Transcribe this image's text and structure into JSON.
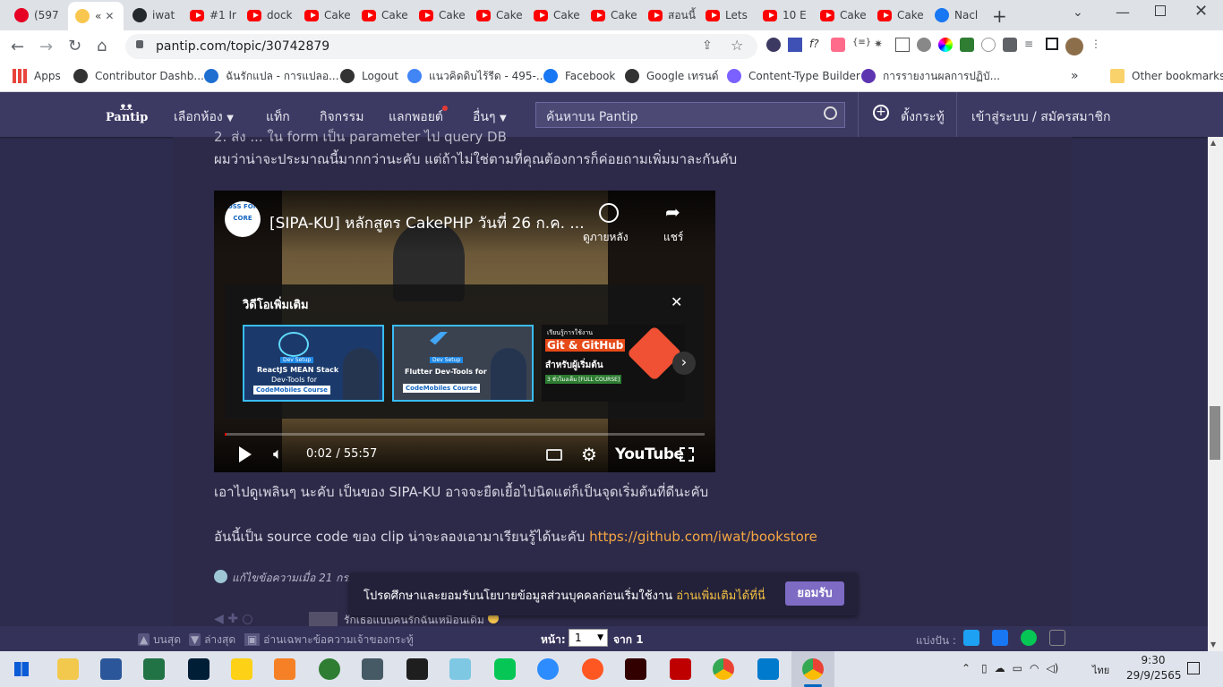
{
  "tabs": [
    {
      "title": "(597",
      "icon": "pinterest"
    },
    {
      "title": "«",
      "icon": "emoji"
    },
    {
      "title": "iwat",
      "icon": "github"
    },
    {
      "title": "#1 Ir",
      "icon": "youtube"
    },
    {
      "title": "dock",
      "icon": "youtube"
    },
    {
      "title": "Cake",
      "icon": "youtube"
    },
    {
      "title": "Cake",
      "icon": "youtube"
    },
    {
      "title": "Cake",
      "icon": "youtube"
    },
    {
      "title": "Cake",
      "icon": "youtube"
    },
    {
      "title": "Cake",
      "icon": "youtube"
    },
    {
      "title": "Cake",
      "icon": "youtube"
    },
    {
      "title": "สอนนี้",
      "icon": "youtube"
    },
    {
      "title": "Lets",
      "icon": "youtube"
    },
    {
      "title": "10 E",
      "icon": "youtube"
    },
    {
      "title": "Cake",
      "icon": "youtube"
    },
    {
      "title": "Cake",
      "icon": "youtube"
    },
    {
      "title": "Nacl",
      "icon": "facebook"
    }
  ],
  "address": {
    "url": "pantip.com/topic/30742879"
  },
  "bookmarks": {
    "apps": "Apps",
    "items": [
      "Contributor Dashb...",
      "ฉันรักแปล - การแปลอ...",
      "Logout",
      "แนวคิดดิบไร้รีด - 495-...",
      "Facebook",
      "Google เทรนด์",
      "Content-Type Builder",
      "การรายงานผลการปฏิบั..."
    ],
    "other": "Other bookmarks"
  },
  "pantip": {
    "logo": "Pantip",
    "nav": [
      "เลือกห้อง",
      "แท็ก",
      "กิจกรรม",
      "แลกพอยต์",
      "อื่นๆ"
    ],
    "search_placeholder": "ค้นหาบน Pantip",
    "create": "ตั้งกระทู้",
    "login": "เข้าสู่ระบบ / สมัครสมาชิก"
  },
  "post": {
    "cut_line": "2. ส่ง ... ใน form เป็น parameter ไป query DB",
    "line1": "ผมว่าน่าจะประมาณนี้มากกว่านะคับ แต่ถ้าไม่ใช่ตามที่คุณต้องการก็ค่อยถามเพิ่มมาละกันคับ",
    "line2": "เอาไปดูเพลินๆ นะคับ เป็นของ SIPA-KU อาจจะยืดเยื้อไปนิดแต่ก็เป็นจุดเริ่มต้นที่ดีนะคับ",
    "line3": "อันนี้เป็น source code ของ clip น่าจะลองเอามาเรียนรู้ได้นะคับ ",
    "link": "https://github.com/iwat/bookstore",
    "edit_note": "แก้ไขข้อความเมื่อ 21 กร...",
    "reply_preview": "รักเธอแบบคนรักฉันเหมือนเดิม"
  },
  "video": {
    "channel_badge": "OSS FOR CORE",
    "title": "[SIPA-KU] หลักสูตร CakePHP วันที่ 26 ก.ค. ...",
    "watch_later": "ดูภายหลัง",
    "share": "แชร์",
    "more_videos": "วิดีโอเพิ่มเติม",
    "thumbs": [
      {
        "big": "ReactJS MEAN Stack",
        "sub": "Dev-Tools for",
        "badge": "CodeMobiles Course",
        "chip": "Dev Setup"
      },
      {
        "big": "Flutter Dev-Tools for",
        "sub": "",
        "badge": "CodeMobiles Course",
        "chip": "Dev Setup"
      },
      {
        "big": "Git & GitHub",
        "sub": "สำหรับผู้เริ่มต้น",
        "badge": "เรียนรู้การใช้งาน",
        "chip": "3 ชั่วโมงเต็ม [FULL COURSE]"
      }
    ],
    "time": "0:02 / 55:57",
    "youtube": "YouTube",
    "progress": 0.0006
  },
  "cookie": {
    "text": "โปรดศึกษาและยอมรับนโยบายข้อมูลส่วนบุคคลก่อนเริ่มใช้งาน ",
    "link": "อ่านเพิ่มเติมได้ที่นี่",
    "button": "ยอมรับ"
  },
  "bottombar": {
    "top": "บนสุด",
    "bottom": "ล่างสุด",
    "owner_only": "อ่านเฉพาะข้อความเจ้าของกระทู้",
    "page_label": "หน้า:",
    "page_value": "1",
    "of": "จาก 1",
    "share": "แบ่งปัน :"
  },
  "taskbar": {
    "time": "9:30",
    "date": "29/9/2565",
    "lang": "ไทย"
  },
  "colors": {
    "pantip_header": "#3c3963",
    "content_bg": "#2d2a49",
    "link": "#f5a742",
    "accent_button": "#7e6bc4"
  }
}
